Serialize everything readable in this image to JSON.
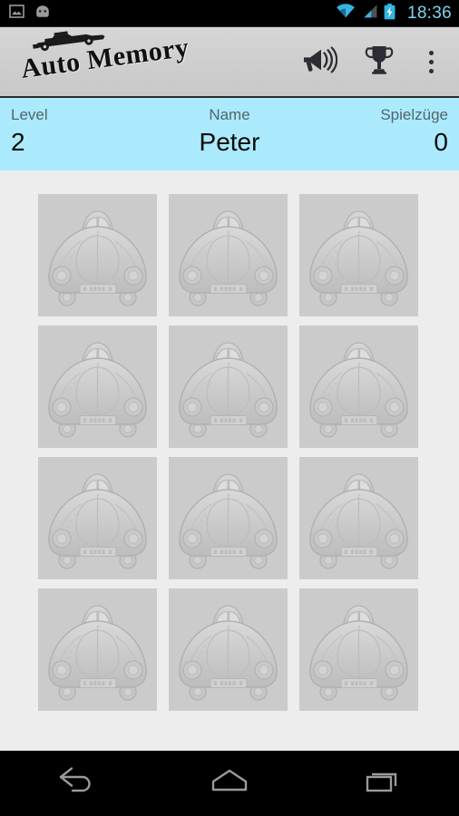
{
  "statusbar": {
    "time": "18:36",
    "icons_left": [
      "screenshot-image-icon",
      "android-head-icon"
    ],
    "icons_right": [
      "wifi-icon",
      "cellular-signal-icon",
      "battery-charging-icon"
    ],
    "accent_color": "#7fd4ef",
    "background": "#000000"
  },
  "actionbar": {
    "app_title": "Auto Memory",
    "logo_icon": "race-car-icon",
    "background": "#cfcfcf",
    "actions": [
      {
        "name": "sound-toggle-button",
        "icon": "megaphone-icon",
        "label": "Ton"
      },
      {
        "name": "highscore-button",
        "icon": "trophy-icon",
        "label": "Highscore"
      },
      {
        "name": "overflow-menu-button",
        "icon": "more-vertical-icon",
        "label": "Mehr"
      }
    ]
  },
  "infobar": {
    "background": "#aaeafc",
    "level_label": "Level",
    "level_value": "2",
    "name_label": "Name",
    "name_value": "Peter",
    "moves_label": "Spielzüge",
    "moves_value": "0"
  },
  "board": {
    "columns": 3,
    "rows": 4,
    "card_back_icon": "vw-beetle-car-icon",
    "card_background": "#cbcbcb",
    "page_background": "#ededed",
    "cards": [
      {
        "id": "card-1",
        "state": "face-down"
      },
      {
        "id": "card-2",
        "state": "face-down"
      },
      {
        "id": "card-3",
        "state": "face-down"
      },
      {
        "id": "card-4",
        "state": "face-down"
      },
      {
        "id": "card-5",
        "state": "face-down"
      },
      {
        "id": "card-6",
        "state": "face-down"
      },
      {
        "id": "card-7",
        "state": "face-down"
      },
      {
        "id": "card-8",
        "state": "face-down"
      },
      {
        "id": "card-9",
        "state": "face-down"
      },
      {
        "id": "card-10",
        "state": "face-down"
      },
      {
        "id": "card-11",
        "state": "face-down"
      },
      {
        "id": "card-12",
        "state": "face-down"
      }
    ]
  },
  "navbar": {
    "background": "#000000",
    "buttons": [
      {
        "name": "nav-back-button",
        "icon": "back-arrow-icon"
      },
      {
        "name": "nav-home-button",
        "icon": "home-icon"
      },
      {
        "name": "nav-recents-button",
        "icon": "recents-icon"
      }
    ]
  }
}
